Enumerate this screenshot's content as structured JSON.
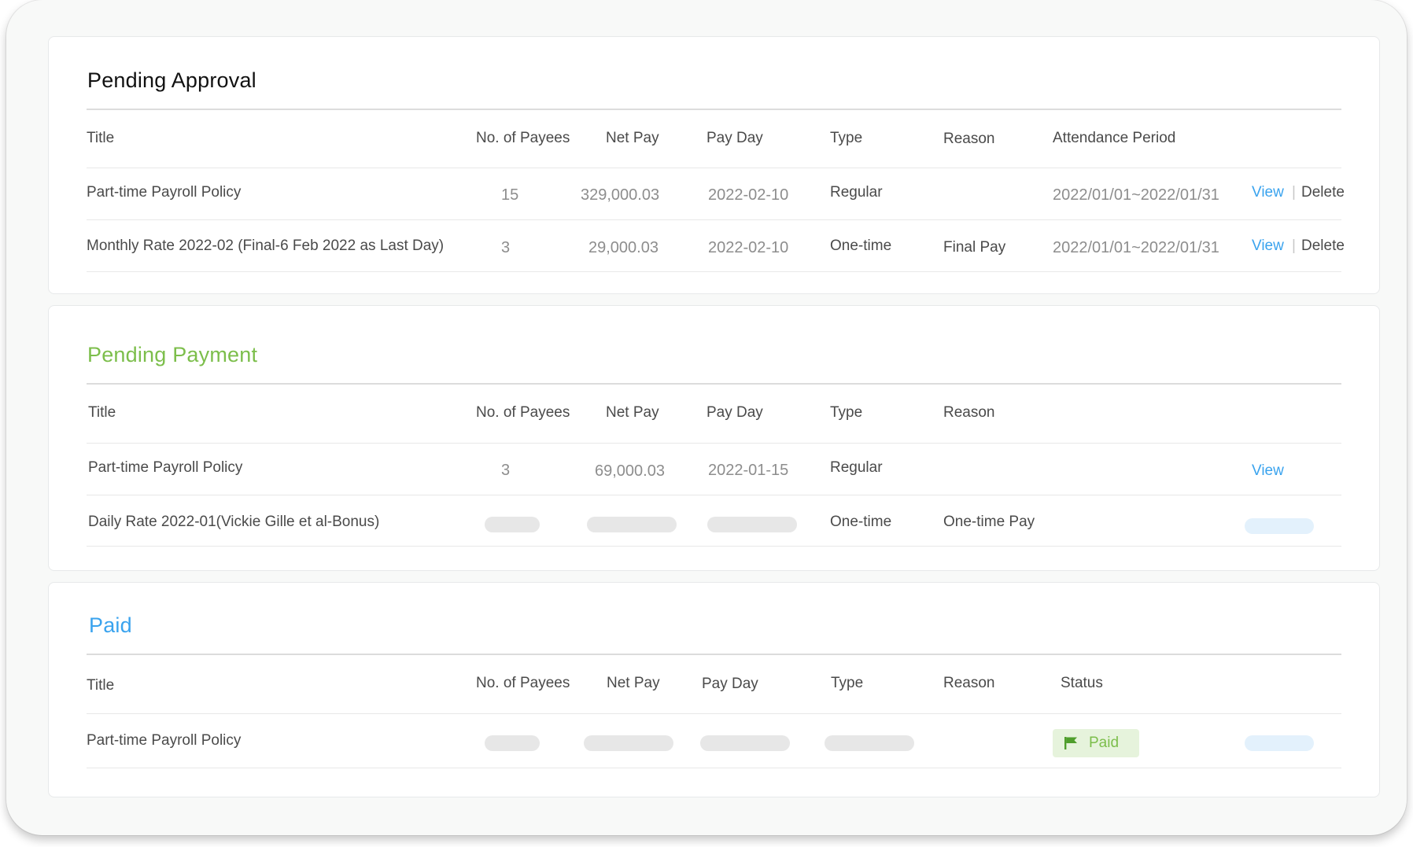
{
  "colors": {
    "green": "#7cbe4b",
    "blue": "#3aa3ee",
    "text": "#4a4a4a",
    "muted": "#8d8d8d"
  },
  "pending_approval": {
    "title": "Pending Approval",
    "headers": [
      "Title",
      "No. of Payees",
      "Net Pay",
      "Pay Day",
      "Type",
      "Reason",
      "Attendance Period"
    ],
    "rows": [
      {
        "title": "Part-time Payroll Policy",
        "payees": "15",
        "net_pay": "329,000.03",
        "pay_day": "2022-02-10",
        "type": "Regular",
        "reason": "",
        "period": "2022/01/01~2022/01/31",
        "view": "View",
        "sep": "|",
        "delete": "Delete"
      },
      {
        "title": "Monthly Rate 2022-02 (Final-6 Feb 2022 as Last Day)",
        "payees": "3",
        "net_pay": "29,000.03",
        "pay_day": "2022-02-10",
        "type": "One-time",
        "reason": "Final Pay",
        "period": "2022/01/01~2022/01/31",
        "view": "View",
        "sep": "|",
        "delete": "Delete"
      }
    ]
  },
  "pending_payment": {
    "title": "Pending Payment",
    "headers": [
      "Title",
      "No. of Payees",
      "Net Pay",
      "Pay Day",
      "Type",
      "Reason"
    ],
    "rows": [
      {
        "title": "Part-time Payroll Policy",
        "payees": "3",
        "net_pay": "69,000.03",
        "pay_day": "2022-01-15",
        "type": "Regular",
        "reason": "",
        "view": "View"
      },
      {
        "title": "Daily Rate 2022-01(Vickie Gille et al-Bonus)",
        "type": "One-time",
        "reason": "One-time Pay"
      }
    ]
  },
  "paid": {
    "title": "Paid",
    "headers": [
      "Title",
      "No. of Payees",
      "Net Pay",
      "Pay Day",
      "Type",
      "Reason",
      "Status"
    ],
    "rows": [
      {
        "title": "Part-time Payroll Policy",
        "status": "Paid",
        "status_icon": "flag-icon"
      }
    ]
  }
}
